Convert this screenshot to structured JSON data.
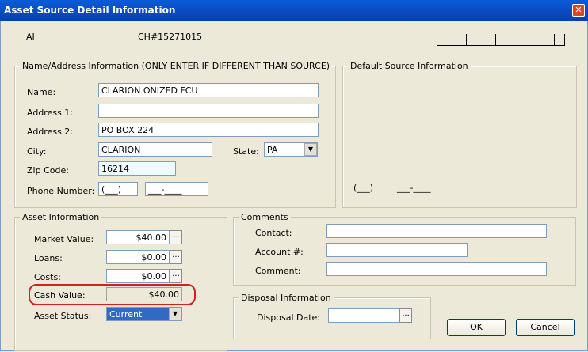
{
  "window": {
    "title": "Asset Source Detail Information",
    "close_glyph": "✕"
  },
  "header": {
    "code": "AI",
    "case_number": "CH#15271015"
  },
  "name_address": {
    "legend": "Name/Address Information (ONLY ENTER IF DIFFERENT THAN SOURCE)",
    "name_label": "Name:",
    "name_value": "CLARION ONIZED FCU",
    "address1_label": "Address 1:",
    "address1_value": "",
    "address2_label": "Address 2:",
    "address2_value": "PO BOX 224",
    "city_label": "City:",
    "city_value": "CLARION",
    "state_label": "State:",
    "state_value": "PA",
    "zip_label": "Zip Code:",
    "zip_value": "16214",
    "phone_label": "Phone Number:",
    "phone_area": "(___)",
    "phone_number": "___-____"
  },
  "default_source": {
    "legend": "Default Source Information",
    "phone_area": "(___)",
    "phone_number": "___-____"
  },
  "asset": {
    "legend": "Asset Information",
    "market_label": "Market Value:",
    "market_value": "$40.00",
    "loans_label": "Loans:",
    "loans_value": "$0.00",
    "costs_label": "Costs:",
    "costs_value": "$0.00",
    "cash_label": "Cash Value:",
    "cash_value": "$40.00",
    "status_label": "Asset Status:",
    "status_value": "Current",
    "ellipsis": "..."
  },
  "comments": {
    "legend": "Comments",
    "contact_label": "Contact:",
    "contact_value": "",
    "account_label": "Account #:",
    "account_value": "",
    "comment_label": "Comment:",
    "comment_value": ""
  },
  "disposal": {
    "legend": "Disposal Information",
    "date_label": "Disposal Date:",
    "date_value": "",
    "ellipsis": "..."
  },
  "buttons": {
    "ok": "OK",
    "cancel": "Cancel"
  },
  "colors": {
    "titlebar": "#0a5cd8",
    "highlight_ring": "#d62020",
    "selection": "#316ac5"
  }
}
